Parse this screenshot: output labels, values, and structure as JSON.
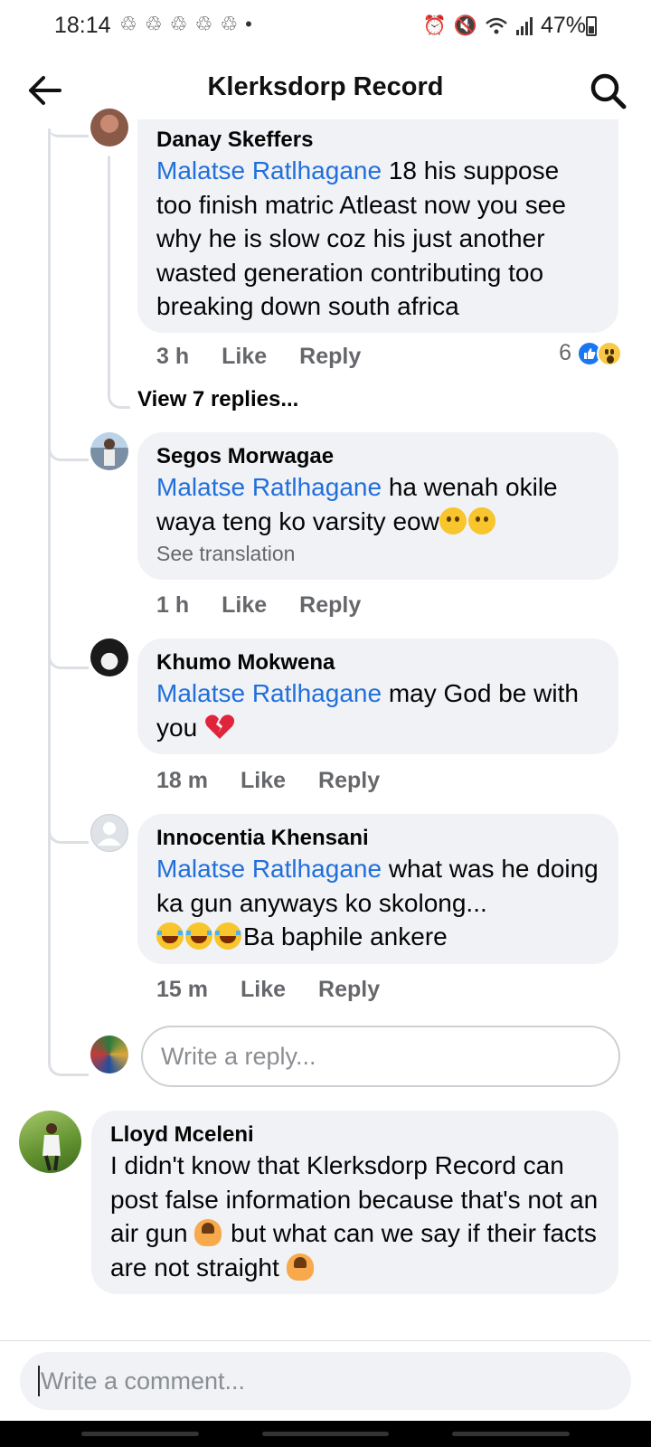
{
  "status_bar": {
    "time": "18:14",
    "notification_icons": "♲ ♲ ♲ ♲ ♲ •",
    "battery": "47%"
  },
  "header": {
    "title": "Klerksdorp Record"
  },
  "comments": [
    {
      "author": "Danay Skeffers",
      "mention": "Malatse Ratlhagane",
      "text": " 18 his suppose too finish matric Atleast now you see why he is slow coz his just another wasted generation contributing too breaking down south africa",
      "time": "3 h",
      "like": "Like",
      "reply": "Reply",
      "reaction_count": "6",
      "view_replies": "View 7 replies..."
    },
    {
      "author": "Segos Morwagae",
      "mention": "Malatse Ratlhagane",
      "text": " ha wenah okile waya teng ko varsity eow",
      "see_translation": "See translation",
      "time": "1 h",
      "like": "Like",
      "reply": "Reply"
    },
    {
      "author": "Khumo Mokwena",
      "mention": "Malatse Ratlhagane",
      "text": " may God be with you ",
      "time": "18 m",
      "like": "Like",
      "reply": "Reply"
    },
    {
      "author": "Innocentia Khensani",
      "mention": "Malatse Ratlhagane",
      "text": " what was he doing ka gun anyways ko skolong...",
      "text_after_emojis": "Ba baphile ankere",
      "time": "15 m",
      "like": "Like",
      "reply": "Reply"
    },
    {
      "author": "Lloyd Mceleni",
      "text_1": "I didn't know that Klerksdorp Record can post false information because that's not an air gun ",
      "text_2": " but what can we say if their facts are not straight "
    }
  ],
  "reply_box": {
    "placeholder": "Write a reply..."
  },
  "comment_box": {
    "placeholder": "Write a comment..."
  },
  "colors": {
    "mention": "#216fdb",
    "bubble": "#f0f2f5",
    "meta": "#65676b",
    "like_reaction": "#1877f2"
  }
}
